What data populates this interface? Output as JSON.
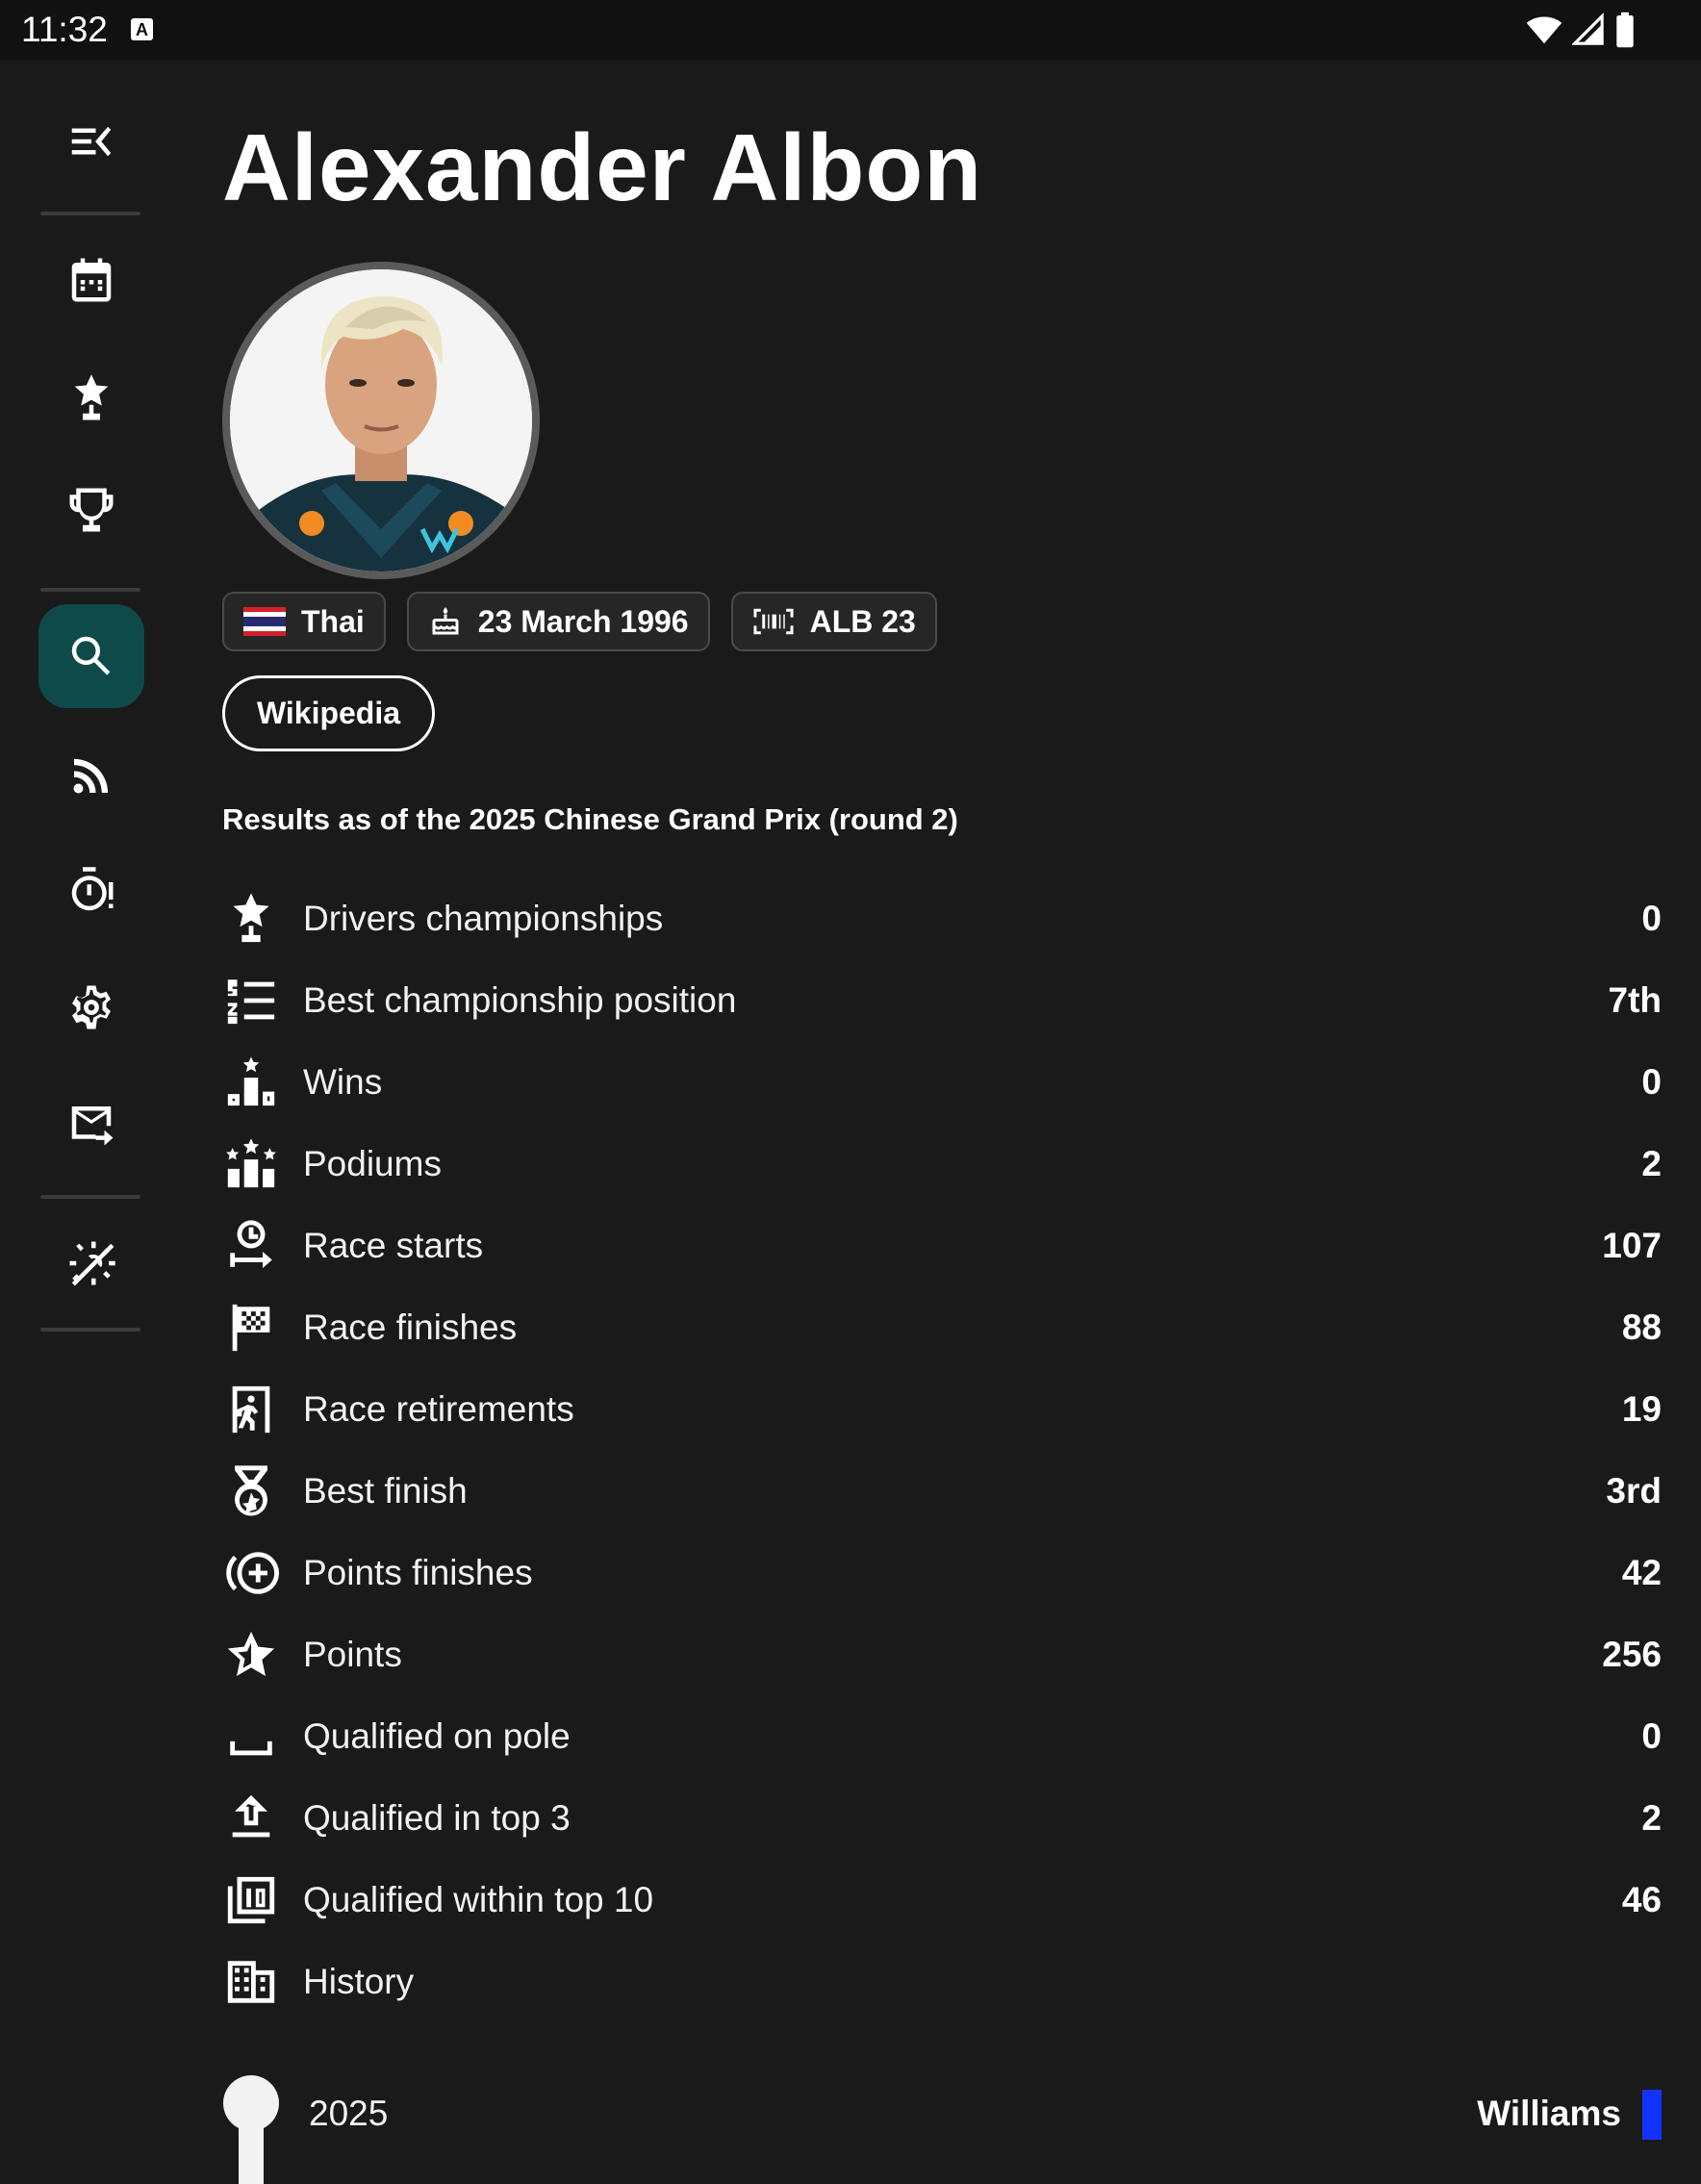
{
  "status_bar": {
    "time": "11:32",
    "notification_badge": "A"
  },
  "nav_rail": {
    "items": [
      {
        "icon": "menu-open-icon"
      },
      {
        "icon": "calendar-icon"
      },
      {
        "icon": "driver-standings-icon"
      },
      {
        "icon": "trophy-icon"
      },
      {
        "icon": "search-icon",
        "active": true
      },
      {
        "icon": "rss-feed-icon"
      },
      {
        "icon": "timer-alert-icon"
      },
      {
        "icon": "settings-icon"
      },
      {
        "icon": "mail-forward-icon"
      },
      {
        "icon": "theme-toggle-icon"
      }
    ]
  },
  "driver": {
    "name": "Alexander Albon",
    "nationality": "Thai",
    "birth_date": "23 March 1996",
    "code": "ALB 23",
    "wikipedia_label": "Wikipedia"
  },
  "results_note": "Results as of the 2025 Chinese Grand Prix (round 2)",
  "stats": [
    {
      "icon": "championship-star-icon",
      "label": "Drivers championships",
      "value": "0"
    },
    {
      "icon": "numbered-list-icon",
      "label": "Best championship position",
      "value": "7th"
    },
    {
      "icon": "podium-star-icon",
      "label": "Wins",
      "value": "0"
    },
    {
      "icon": "podium-stars-icon",
      "label": "Podiums",
      "value": "2"
    },
    {
      "icon": "race-start-icon",
      "label": "Race starts",
      "value": "107"
    },
    {
      "icon": "checkered-flag-icon",
      "label": "Race finishes",
      "value": "88"
    },
    {
      "icon": "exit-door-icon",
      "label": "Race retirements",
      "value": "19"
    },
    {
      "icon": "medal-icon",
      "label": "Best finish",
      "value": "3rd"
    },
    {
      "icon": "add-circle-icon",
      "label": "Points finishes",
      "value": "42"
    },
    {
      "icon": "star-outline-icon",
      "label": "Points",
      "value": "256"
    },
    {
      "icon": "pole-bracket-icon",
      "label": "Qualified on pole",
      "value": "0"
    },
    {
      "icon": "upload-arrow-icon",
      "label": "Qualified in top 3",
      "value": "2"
    },
    {
      "icon": "top-10-icon",
      "label": "Qualified within top 10",
      "value": "46"
    },
    {
      "icon": "history-building-icon",
      "label": "History",
      "value": ""
    }
  ],
  "history": [
    {
      "year": "2025",
      "team": "Williams",
      "team_color": "#1432ff"
    }
  ],
  "colors": {
    "background": "#1a1a1a",
    "rail_active": "#0f4a4a",
    "thai_flag_red": "#d5202b",
    "thai_flag_blue": "#2a2a6e"
  }
}
